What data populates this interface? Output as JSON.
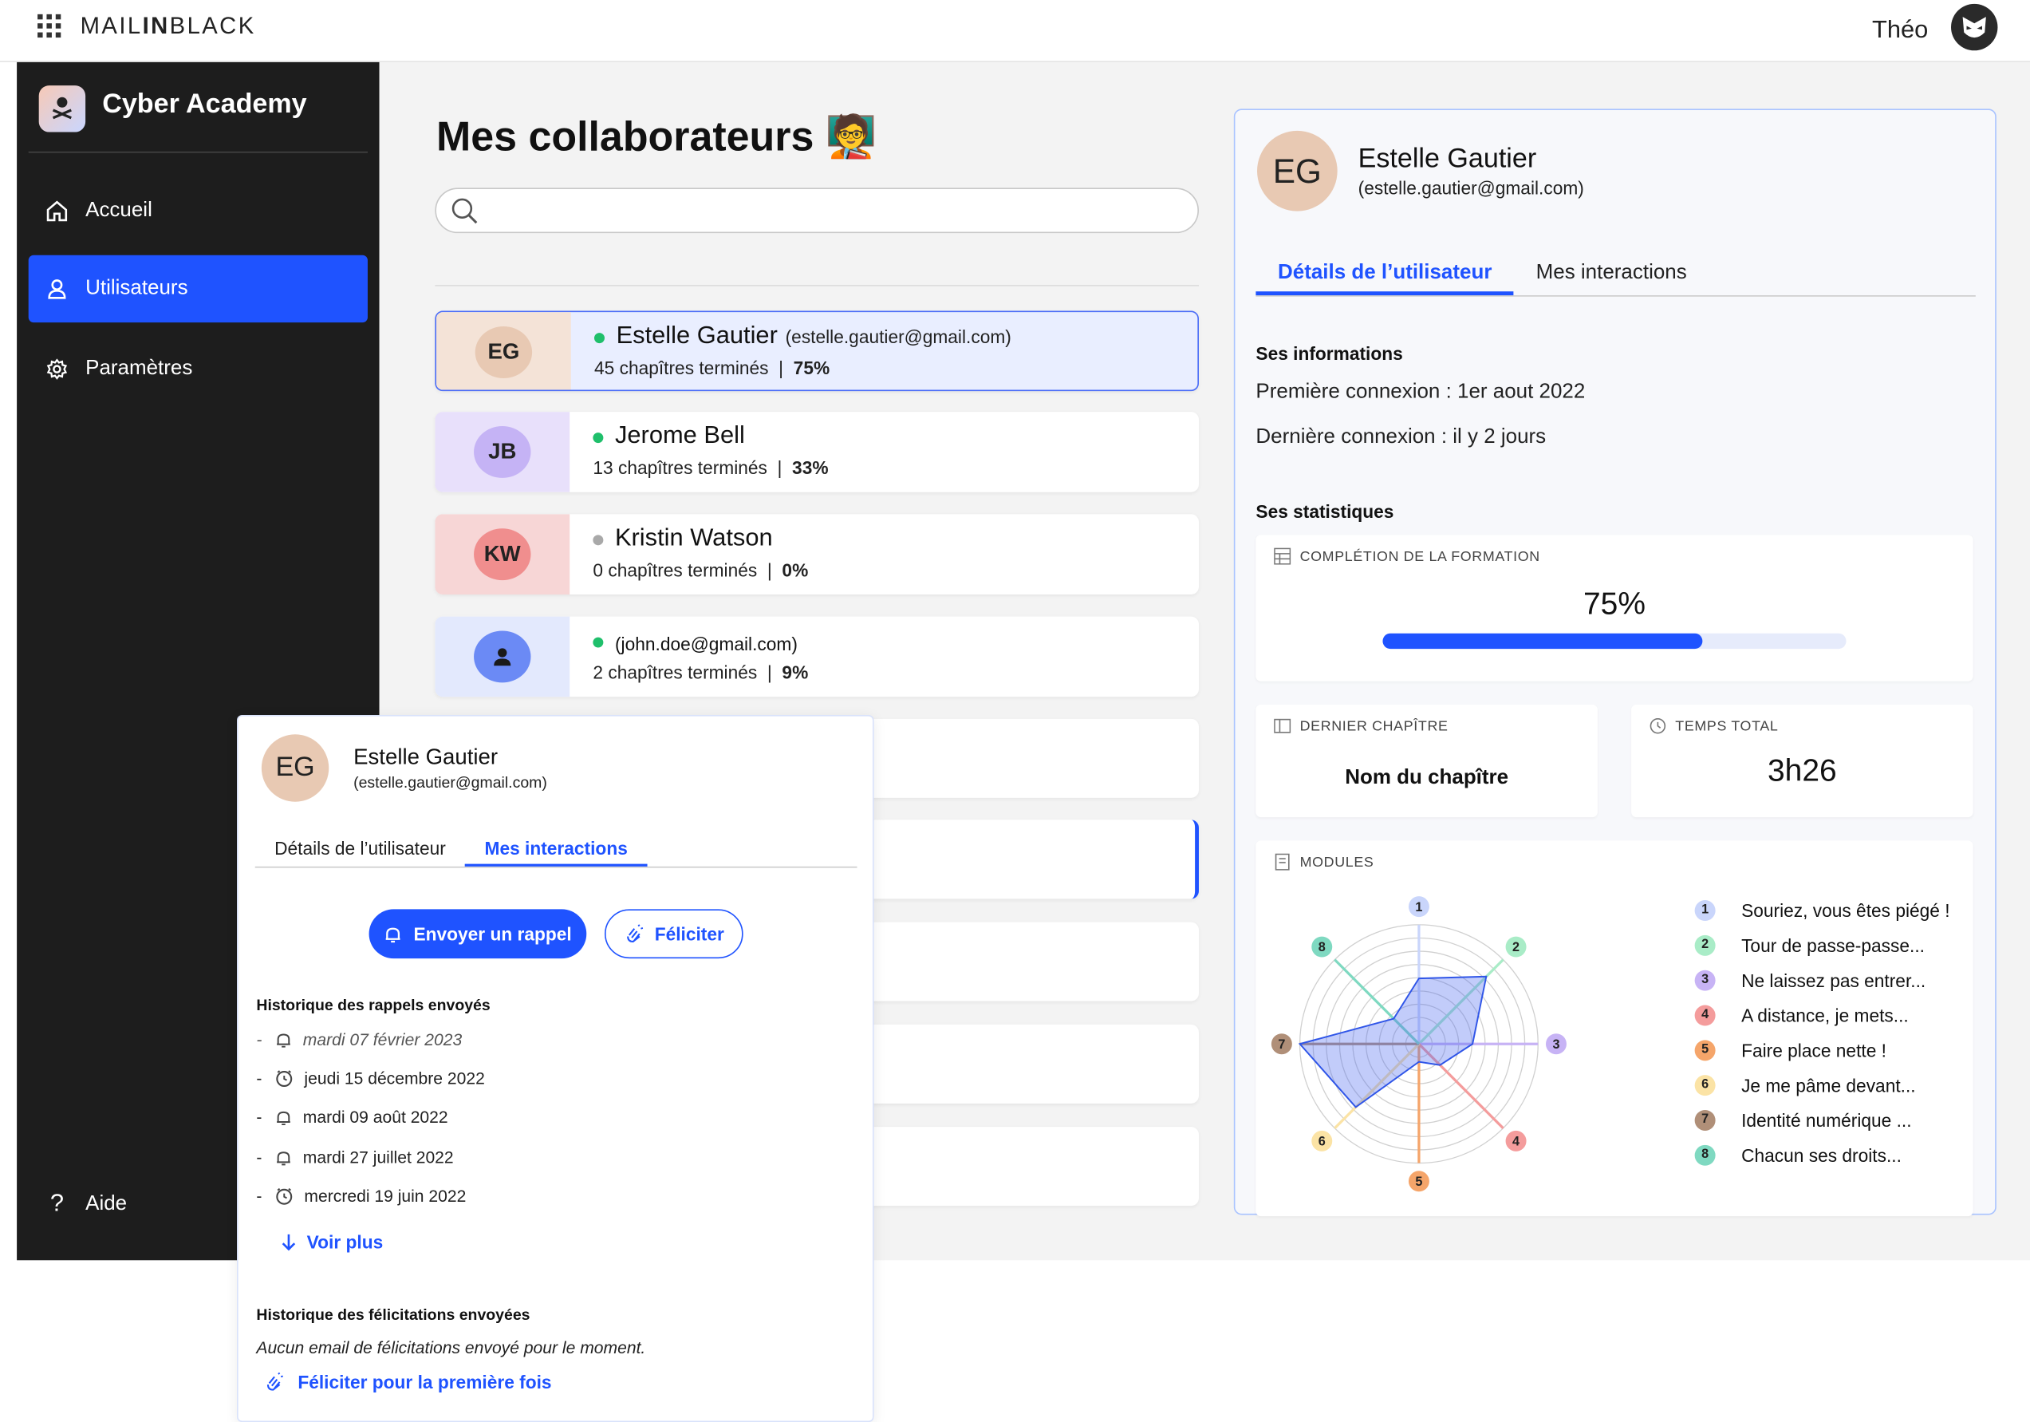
{
  "topbar": {
    "brand_prefix": "MAIL",
    "brand_mid": "IN",
    "brand_suffix": "BLACK",
    "username": "Théo"
  },
  "sidebar": {
    "title": "Cyber Academy",
    "items": [
      {
        "label": "Accueil",
        "icon": "home-icon",
        "active": false
      },
      {
        "label": "Utilisateurs",
        "icon": "user-icon",
        "active": true
      },
      {
        "label": "Paramètres",
        "icon": "gear-icon",
        "active": false
      }
    ],
    "help_label": "Aide"
  },
  "main": {
    "title": "Mes collaborateurs",
    "title_emoji": "🧑‍🏫",
    "search": {
      "placeholder": "",
      "value": ""
    },
    "users": [
      {
        "initials": "EG",
        "name": "Estelle Gautier",
        "email": "(estelle.gautier@gmail.com)",
        "chapters": "45 chapîtres terminés",
        "pct": "75%",
        "status": "active",
        "selected": true,
        "avatar_color": "#e8c9b3",
        "row_color": "#f4e3d7"
      },
      {
        "initials": "JB",
        "name": "Jerome Bell",
        "email": "",
        "chapters": "13 chapîtres terminés",
        "pct": "33%",
        "status": "active",
        "selected": false,
        "avatar_color": "#c5b3f5",
        "row_color": "#e8e0fb"
      },
      {
        "initials": "KW",
        "name": "Kristin Watson",
        "email": "",
        "chapters": "0 chapîtres terminés",
        "pct": "0%",
        "status": "inactive",
        "selected": false,
        "avatar_color": "#f08e8e",
        "row_color": "#f7d6d6"
      },
      {
        "initials": "",
        "name": "",
        "email": "(john.doe@gmail.com)",
        "chapters": "2 chapîtres terminés",
        "pct": "9%",
        "status": "active",
        "selected": false,
        "avatar_color": "#6b8af5",
        "row_color": "#e3e9fd"
      }
    ],
    "separator": "|"
  },
  "detail": {
    "initials": "EG",
    "name": "Estelle Gautier",
    "email": "(estelle.gautier@gmail.com)",
    "tabs": [
      "Détails de l’utilisateur",
      "Mes interactions"
    ],
    "active_tab": 0,
    "info_title": "Ses informations",
    "first_login": "Première connexion : 1er aout 2022",
    "last_login": "Dernière connexion : il y 2 jours",
    "stats_title": "Ses statistiques",
    "completion": {
      "label": "COMPLÉTION DE LA FORMATION",
      "value": "75%",
      "fraction": 0.69
    },
    "last_chapter": {
      "label": "DERNIER CHAPÎTRE",
      "value": "Nom du chapître"
    },
    "total_time": {
      "label": "TEMPS TOTAL",
      "value": "3h26"
    },
    "modules": {
      "label": "MODULES",
      "items": [
        {
          "n": "1",
          "label": "Souriez, vous êtes piégé !",
          "color": "#c9d5fb",
          "score": 0.55
        },
        {
          "n": "2",
          "label": "Tour de passe-passe...",
          "color": "#a9ecc7",
          "score": 0.8
        },
        {
          "n": "3",
          "label": "Ne laissez pas entrer...",
          "color": "#c7b3f5",
          "score": 0.45
        },
        {
          "n": "4",
          "label": "A distance, je mets...",
          "color": "#f49c9c",
          "score": 0.25
        },
        {
          "n": "5",
          "label": "Faire place nette !",
          "color": "#f5a56a",
          "score": 0.15
        },
        {
          "n": "6",
          "label": "Je me pâme devant...",
          "color": "#fbe3a5",
          "score": 0.75
        },
        {
          "n": "7",
          "label": "Identité numérique ...",
          "color": "#b08f78",
          "score": 1.0
        },
        {
          "n": "8",
          "label": "Chacun ses droits...",
          "color": "#7fd9c1",
          "score": 0.3
        }
      ]
    }
  },
  "popover": {
    "initials": "EG",
    "name": "Estelle Gautier",
    "email": "(estelle.gautier@gmail.com)",
    "tabs": [
      "Détails de l’utilisateur",
      "Mes interactions"
    ],
    "active_tab": 1,
    "btn_reminder": "Envoyer un rappel",
    "btn_congrats": "Féliciter",
    "reminders_title": "Historique des rappels envoyés",
    "reminders": [
      {
        "date": "mardi 07 février 2023",
        "type": "bell-icon",
        "italic": true
      },
      {
        "date": "jeudi 15 décembre 2022",
        "type": "alarm-icon",
        "italic": false
      },
      {
        "date": "mardi 09 août 2022",
        "type": "bell-icon",
        "italic": false
      },
      {
        "date": "mardi 27 juillet 2022",
        "type": "bell-icon",
        "italic": false
      },
      {
        "date": "mercredi 19 juin 2022",
        "type": "alarm-icon",
        "italic": false
      }
    ],
    "dash": "-",
    "see_more": "Voir plus",
    "congrats_title": "Historique des félicitations envoyées",
    "congrats_empty": "Aucun email de félicitations envoyé pour le moment.",
    "congrats_first": "Féliciter pour la première fois"
  }
}
